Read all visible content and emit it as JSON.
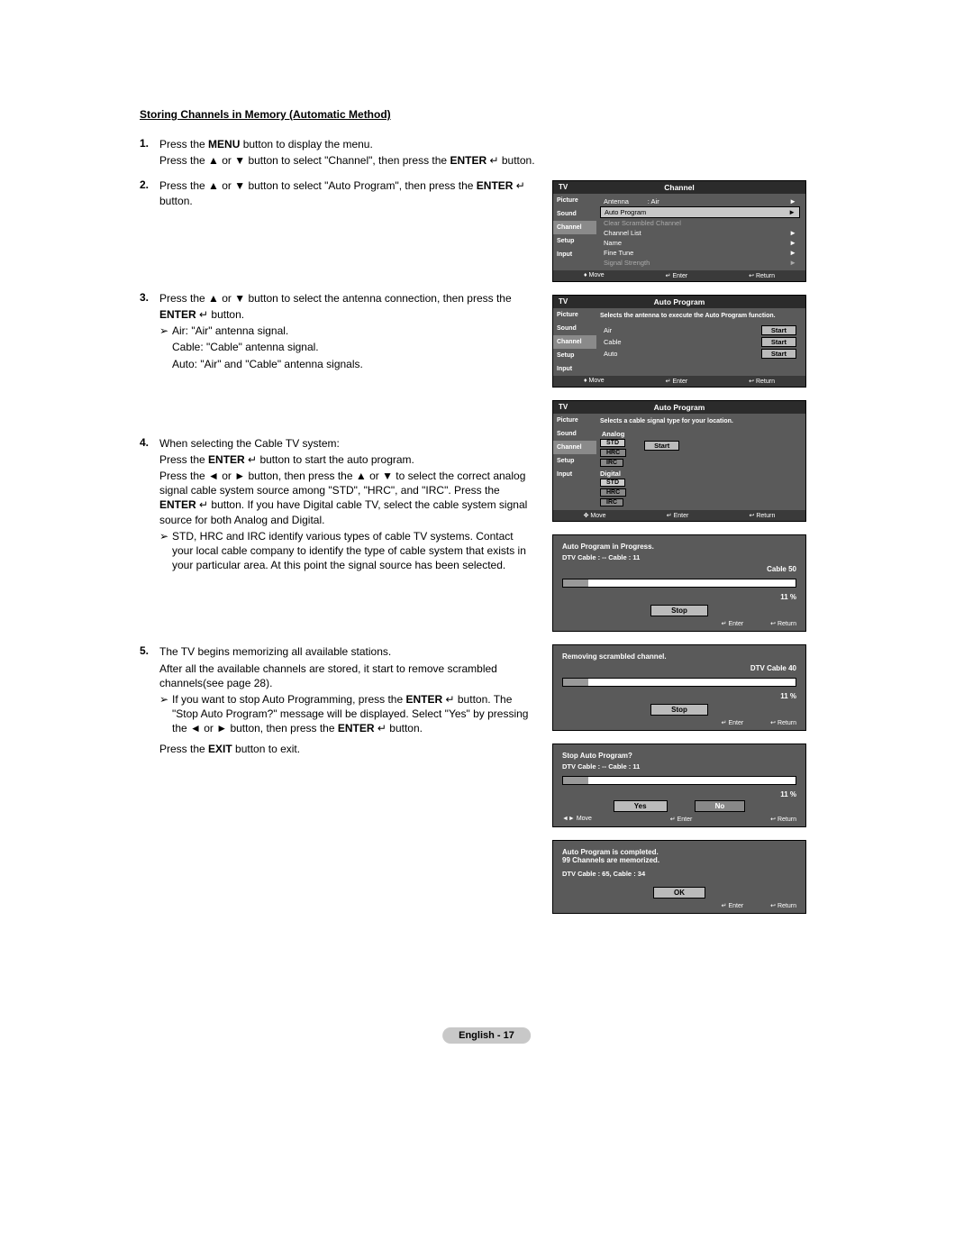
{
  "heading": "Storing Channels in Memory (Automatic Method)",
  "steps": {
    "s1": {
      "num": "1.",
      "l1a": "Press the ",
      "l1b": "MENU",
      "l1c": " button to display the menu.",
      "l2a": "Press the ▲ or ▼ button to select \"Channel\", then press the ",
      "l2b": "ENTER",
      "l2c": " button."
    },
    "s2": {
      "num": "2.",
      "l1a": "Press the ▲ or ▼ button to select \"Auto Program\", then press the ",
      "l1b": "ENTER",
      "l1c": " button."
    },
    "s3": {
      "num": "3.",
      "l1a": "Press the ▲ or ▼ button to select the antenna connection, then press the",
      "l2a": "ENTER ",
      "l2b": " button.",
      "n1": "Air: \"Air\" antenna signal.",
      "n2": "Cable: \"Cable\" antenna signal.",
      "n3": "Auto: \"Air\" and \"Cable\" antenna signals."
    },
    "s4": {
      "num": "4.",
      "l1": "When selecting the Cable TV system:",
      "l2a": "Press the ",
      "l2b": "ENTER",
      "l2c": " button to start the auto program.",
      "l3a": "Press the ◄ or ► button, then press the ▲ or ▼ to select the correct analog signal cable system source among \"STD\", \"HRC\", and \"IRC\". Press the ",
      "l3b": "ENTER",
      "l3c": " button. If you have Digital cable TV, select the cable system signal source for both Analog and Digital.",
      "note": "STD, HRC and IRC identify various types of cable TV systems. Contact your local cable company to identify the type of cable system that exists in your particular area. At this point the signal source has been selected."
    },
    "s5": {
      "num": "5.",
      "l1": "The TV begins memorizing all available stations.",
      "l2": "After all the available channels are stored, it start to remove scrambled channels(see page 28).",
      "note_a": "If you want to stop Auto Programming, press the ",
      "note_b": "ENTER",
      "note_c": " button. The \"Stop Auto Program?\" message will be displayed. Select \"Yes\" by pressing the ◄ or ► button, then press the ",
      "note_d": "ENTER",
      "note_e": " button.",
      "l3a": "Press the ",
      "l3b": "EXIT",
      "l3c": " button to exit."
    }
  },
  "sideLabels": {
    "picture": "Picture",
    "sound": "Sound",
    "channel": "Channel",
    "setup": "Setup",
    "input": "Input"
  },
  "footerBtns": {
    "move": "Move",
    "enter": "Enter",
    "return": "Return"
  },
  "osd1": {
    "tv": "TV",
    "title": "Channel",
    "rows": {
      "antenna": {
        "l": "Antenna",
        "v": ": Air"
      },
      "auto": {
        "l": "Auto Program"
      },
      "clear": {
        "l": "Clear Scrambled Channel"
      },
      "list": {
        "l": "Channel List"
      },
      "name": {
        "l": "Name"
      },
      "fine": {
        "l": "Fine Tune"
      },
      "signal": {
        "l": "Signal Strength"
      }
    }
  },
  "osd2": {
    "tv": "TV",
    "title": "Auto Program",
    "desc": "Selects the antenna to execute the Auto Program function.",
    "rows": {
      "air": "Air",
      "cable": "Cable",
      "auto": "Auto",
      "start": "Start"
    }
  },
  "osd3": {
    "tv": "TV",
    "title": "Auto Program",
    "desc": "Selects a cable signal type for your location.",
    "analog": "Analog",
    "digital": "Digital",
    "std": "STD",
    "hrc": "HRC",
    "irc": "IRC",
    "start": "Start"
  },
  "osd4": {
    "title": "Auto Program in Progress.",
    "line": "DTV Cable :  --       Cable : 11",
    "r1": "Cable   50",
    "r2": "11   %",
    "stop": "Stop"
  },
  "osd5": {
    "title": "Removing scrambled channel.",
    "r1": "DTV Cable 40",
    "r2": "11   %",
    "stop": "Stop"
  },
  "osd6": {
    "title": "Stop Auto Program?",
    "line": "DTV Cable :  --       Cable : 11",
    "r2": "11   %",
    "yes": "Yes",
    "no": "No"
  },
  "osd7": {
    "t1": "Auto Program is completed.",
    "t2": "99 Channels are memorized.",
    "line": "DTV Cable : 65, Cable : 34",
    "ok": "OK"
  },
  "enter_icon": "↵",
  "page_footer": "English - 17",
  "arrow_note": "➢"
}
